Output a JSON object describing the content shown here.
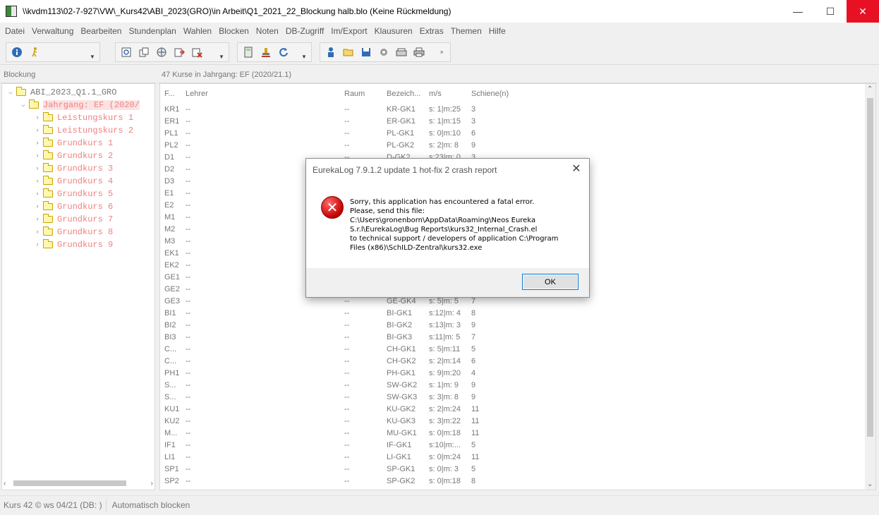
{
  "window": {
    "title": "\\\\kvdm113\\02-7-927\\VW\\_Kurs42\\ABI_2023(GRO)\\in Arbeit\\Q1_2021_22_Blockung halb.blo (Keine Rückmeldung)",
    "minimize": "—",
    "maximize": "☐",
    "close": "✕"
  },
  "menu": [
    "Datei",
    "Verwaltung",
    "Bearbeiten",
    "Stundenplan",
    "Wahlen",
    "Blocken",
    "Noten",
    "DB-Zugriff",
    "Im/Export",
    "Klausuren",
    "Extras",
    "Themen",
    "Hilfe"
  ],
  "left_panel": {
    "header": "Blockung",
    "tree": {
      "root": "ABI_2023_Q1.1_GRO",
      "year": "Jahrgang: EF (2020/",
      "children": [
        "Leistungskurs 1",
        "Leistungskurs 2",
        "Grundkurs 1",
        "Grundkurs 2",
        "Grundkurs 3",
        "Grundkurs 4",
        "Grundkurs 5",
        "Grundkurs 6",
        "Grundkurs 7",
        "Grundkurs 8",
        "Grundkurs 9"
      ]
    }
  },
  "right_panel": {
    "header": "47 Kurse in Jahrgang: EF (2020/21.1)",
    "columns": [
      "F...",
      "Lehrer",
      "Raum",
      "Bezeich...",
      "m/s",
      "Schiene(n)"
    ],
    "rows": [
      [
        "KR1",
        "--",
        "--",
        "KR-GK1",
        "s: 1|m:25",
        "3"
      ],
      [
        "ER1",
        "--",
        "--",
        "ER-GK1",
        "s: 1|m:15",
        "3"
      ],
      [
        "PL1",
        "--",
        "--",
        "PL-GK1",
        "s: 0|m:10",
        "6"
      ],
      [
        "PL2",
        "--",
        "--",
        "PL-GK2",
        "s: 2|m: 8",
        "9"
      ],
      [
        "D1",
        "--",
        "--",
        "D-GK2",
        "s:23|m: 0",
        "3"
      ],
      [
        "D2",
        "--",
        "",
        "",
        "",
        ""
      ],
      [
        "D3",
        "--",
        "",
        "",
        "",
        ""
      ],
      [
        "E1",
        "--",
        "",
        "",
        "",
        ""
      ],
      [
        "E2",
        "--",
        "",
        "",
        "",
        ""
      ],
      [
        "M1",
        "--",
        "",
        "",
        "",
        ""
      ],
      [
        "M2",
        "--",
        "",
        "",
        "",
        ""
      ],
      [
        "M3",
        "--",
        "",
        "",
        "",
        ""
      ],
      [
        "EK1",
        "--",
        "",
        "",
        "",
        ""
      ],
      [
        "EK2",
        "--",
        "",
        "",
        "",
        ""
      ],
      [
        "GE1",
        "--",
        "",
        "",
        "",
        ""
      ],
      [
        "GE2",
        "--",
        "",
        "",
        "",
        ""
      ],
      [
        "GE3",
        "--",
        "--",
        "GE-GK4",
        "s: 5|m: 5",
        "7"
      ],
      [
        "BI1",
        "--",
        "--",
        "BI-GK1",
        "s:12|m: 4",
        "8"
      ],
      [
        "BI2",
        "--",
        "--",
        "BI-GK2",
        "s:13|m: 3",
        "9"
      ],
      [
        "BI3",
        "--",
        "--",
        "BI-GK3",
        "s:11|m: 5",
        "7"
      ],
      [
        "C...",
        "--",
        "--",
        "CH-GK1",
        "s: 5|m:11",
        "5"
      ],
      [
        "C...",
        "--",
        "--",
        "CH-GK2",
        "s: 2|m:14",
        "6"
      ],
      [
        "PH1",
        "--",
        "--",
        "PH-GK1",
        "s: 9|m:20",
        "4"
      ],
      [
        "S...",
        "--",
        "--",
        "SW-GK2",
        "s: 1|m: 9",
        "9"
      ],
      [
        "S...",
        "--",
        "--",
        "SW-GK3",
        "s: 3|m: 8",
        "9"
      ],
      [
        "KU1",
        "--",
        "--",
        "KU-GK2",
        "s: 2|m:24",
        "11"
      ],
      [
        "KU2",
        "--",
        "--",
        "KU-GK3",
        "s: 3|m:22",
        "11"
      ],
      [
        "M...",
        "--",
        "--",
        "MU-GK1",
        "s: 0|m:18",
        "11"
      ],
      [
        "IF1",
        "--",
        "--",
        "IF-GK1",
        "s:10|m:...",
        "5"
      ],
      [
        "LI1",
        "--",
        "--",
        "LI-GK1",
        "s: 0|m:24",
        "11"
      ],
      [
        "SP1",
        "--",
        "--",
        "SP-GK1",
        "s: 0|m: 3",
        "5"
      ],
      [
        "SP2",
        "--",
        "--",
        "SP-GK2",
        "s: 0|m:18",
        "8"
      ]
    ]
  },
  "status": {
    "left": "Kurs 42 © ws 04/21 (DB: )",
    "right": "Automatisch blocken"
  },
  "dialog": {
    "title": "EurekaLog 7.9.1.2 update 1 hot-fix 2 crash report",
    "close": "✕",
    "lines": [
      "Sorry, this application has encountered a fatal error.",
      "Please, send this file:",
      "C:\\Users\\gronenborn\\AppData\\Roaming\\Neos Eureka",
      "S.r.l\\EurekaLog\\Bug Reports\\kurs32_Internal_Crash.el",
      "to technical support / developers of application C:\\Program",
      "Files (x86)\\SchILD-Zentral\\kurs32.exe"
    ],
    "ok": "OK",
    "error_glyph": "✕"
  }
}
